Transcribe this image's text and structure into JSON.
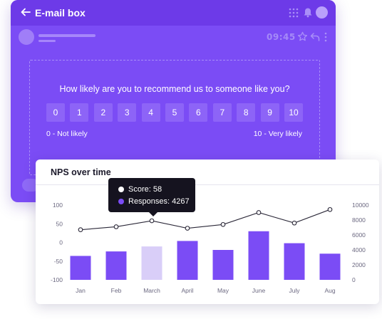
{
  "email": {
    "title": "E-mail box",
    "time": "09:45",
    "survey": {
      "question": "How likely are you to recommend us to someone like you?",
      "scale": [
        "0",
        "1",
        "2",
        "3",
        "4",
        "5",
        "6",
        "7",
        "8",
        "9",
        "10"
      ],
      "low_label": "0 - Not likely",
      "high_label": "10 - Very likely"
    }
  },
  "nps_card": {
    "title": "NPS over time"
  },
  "tooltip": {
    "score_label": "Score: 58",
    "responses_label": "Responses: 4267"
  },
  "colors": {
    "email_bg": "#7b4cf5",
    "bar": "#7b4cf5",
    "bar_highlight": "#d9cef8",
    "line": "#2b2838",
    "tooltip_bg": "#15131f"
  },
  "chart_data": {
    "type": "bar",
    "title": "NPS over time",
    "categories": [
      "Jan",
      "Feb",
      "March",
      "April",
      "May",
      "June",
      "July",
      "Aug"
    ],
    "left_axis": {
      "ticks": [
        "100",
        "50",
        "0",
        "-50",
        "-100"
      ],
      "ylim": [
        -100,
        100
      ]
    },
    "right_axis": {
      "ticks": [
        "10000",
        "8000",
        "6000",
        "4000",
        "2000",
        "0"
      ],
      "ylim": [
        0,
        10000
      ]
    },
    "series": [
      {
        "name": "Responses",
        "type": "bar",
        "axis": "right",
        "values": [
          3200,
          3800,
          4467,
          5200,
          4000,
          6500,
          4900,
          3500
        ]
      },
      {
        "name": "Score",
        "type": "line",
        "axis": "left",
        "values": [
          34,
          42,
          58,
          38,
          48,
          80,
          52,
          88
        ]
      }
    ],
    "highlighted_category": "March",
    "grid": true,
    "legend": "none"
  }
}
